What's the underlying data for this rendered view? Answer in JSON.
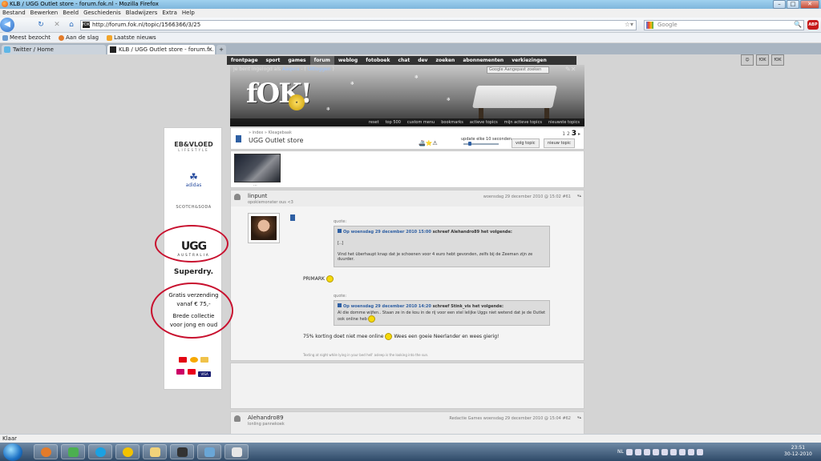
{
  "window": {
    "title": "KLB / UGG Outlet store - forum.fok.nl - Mozilla Firefox"
  },
  "menu": [
    "Bestand",
    "Bewerken",
    "Beeld",
    "Geschiedenis",
    "Bladwijzers",
    "Extra",
    "Help"
  ],
  "nav": {
    "url": "http://forum.fok.nl/topic/1566366/3/25",
    "search_placeholder": "Google",
    "abp_label": "ABP"
  },
  "bookmarks": [
    "Meest bezocht",
    "Aan de slag",
    "Laatste nieuws"
  ],
  "tabs": [
    {
      "label": "Twitter / Home"
    },
    {
      "label": "KLB / UGG Outlet store - forum.f..."
    }
  ],
  "forum": {
    "topnav": [
      "frontpage",
      "sport",
      "games",
      "forum",
      "weblog",
      "fotoboek",
      "chat",
      "dev",
      "zoeken",
      "abonnementen",
      "verkiezingen"
    ],
    "active_nav": "forum",
    "logged_in_prefix": "Je bent ingelogd als",
    "logged_in_user": "Aaqvra",
    "logout": "Uitloggen",
    "search_label": "Google",
    "search_placeholder": "Aangepast zoeken",
    "logo_text": "fOK!",
    "banner_links": [
      "reset",
      "top 500",
      "custom menu",
      "bookmarks",
      "actieve topics",
      "mijn actieve topics",
      "nieuwste topics"
    ],
    "breadcrumb": [
      "index",
      "Kleagebaak"
    ],
    "topic_title": "UGG Outlet store",
    "pages": [
      "1",
      "2",
      "3"
    ],
    "current_page": "3",
    "update_label": "update elke 10 seconden",
    "follow_button": "volg topic",
    "new_topic_button": "nieuw topic",
    "thumb_caption": "..."
  },
  "post1": {
    "author": "linpunt",
    "subtitle": "opokiemonster ous <3",
    "date": "woensdag 29 december 2010 @ 15:02",
    "number": "#61",
    "quote_label": "quote:",
    "quote1_date": "Op woensdag 29 december 2010 15:00",
    "quote1_who": "schreef Alehandro89 het volgende:",
    "quote1_ellipsis": "[..]",
    "quote1_text": "Vind het überhaupt knap dat je schoenen voor 4 euro hebt gevonden, zelfs bij de Zeeman zijn ze duurder.",
    "reply1": "PRIMARK",
    "quote2_date": "Op woensdag 29 december 2010 14:20",
    "quote2_who": "schreef Stink_vis het volgende:",
    "quote2_text": "Al die domme wijfen.. Staan ze in de kou in de rij voor een stel lelijke Uggs niet wetend dat je de Outlet ook online heb",
    "reply2_a": "75% korting doet niet mee online",
    "reply2_b": "Wees een goeie Neerlander en wees gierig!",
    "signature": "Texting at night while lying in your bed hell' asleep is the looking into the sun."
  },
  "post2": {
    "author": "Alehandro89",
    "subtitle": "lonling pannekoek",
    "date": "Redactie Games   woensdag 29 december 2010 @ 15:04",
    "number": "#62"
  },
  "ad": {
    "eb_vloed": "EB&VLOED",
    "eb_vloed_sub": "LIFESTYLE",
    "adidas": "adidas",
    "scotch": "SCOTCH&SODA",
    "ugg": "UGG",
    "ugg_sub": "AUSTRALIA",
    "superdry": "Superdry.",
    "gratis_1": "Gratis verzending",
    "gratis_2": "vanaf € 75,-",
    "gratis_3": "Brede collectie",
    "gratis_4": "voor jong en oud",
    "visa": "VISA"
  },
  "status": {
    "text": "Klaar"
  },
  "tray": {
    "lang": "NL",
    "time": "23:51",
    "date": "30-12-2010"
  },
  "colors": {
    "accent": "#2e5fa3",
    "annotation": "#c8102e"
  }
}
